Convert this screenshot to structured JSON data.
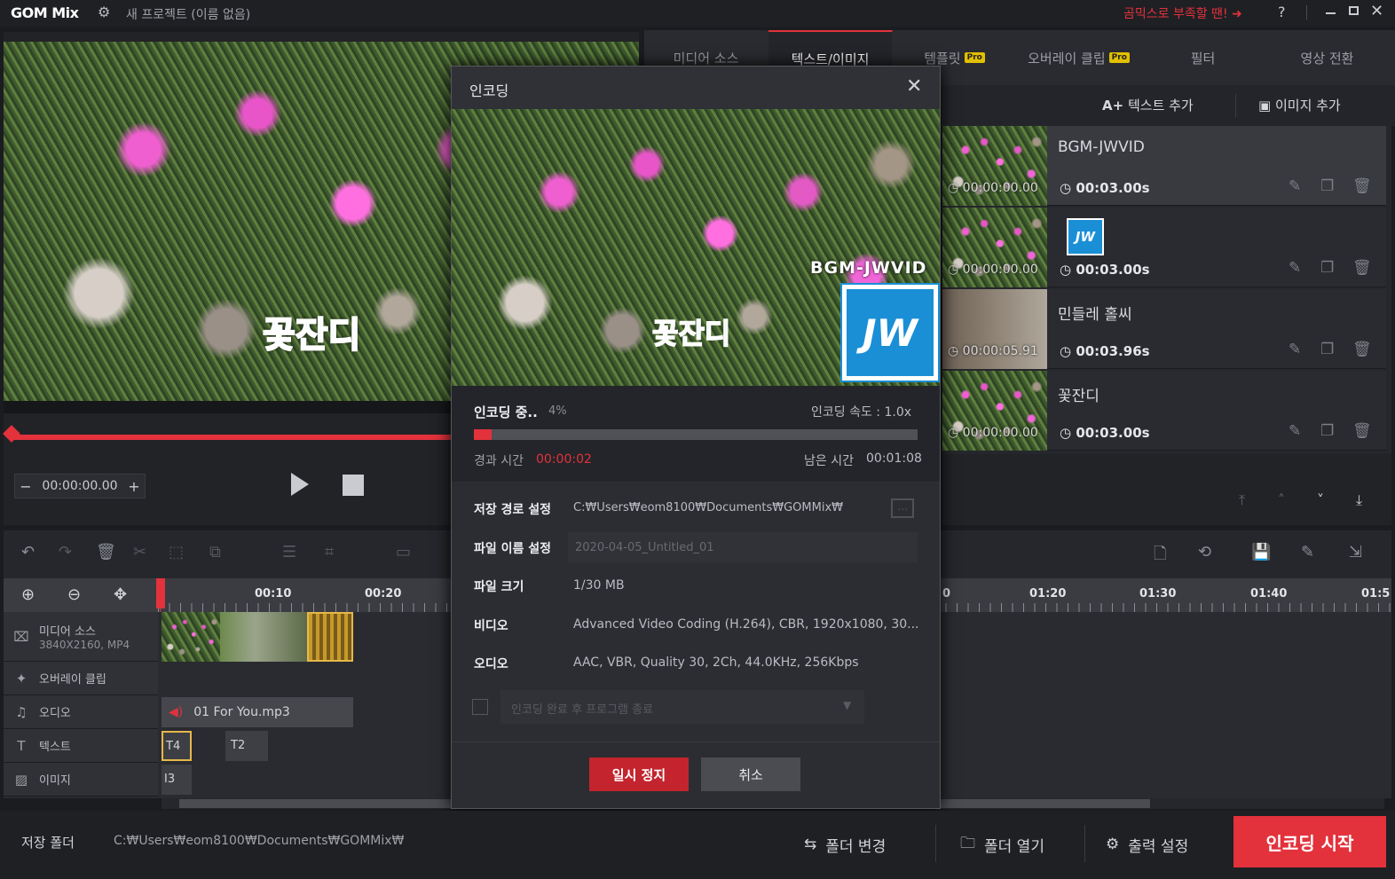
{
  "app": {
    "logo": "GOM Mix",
    "project_title": "새 프로젝트 (이름 없음)",
    "promo": "곰믹스로 부족할 땐! ➜",
    "help": "?"
  },
  "tabs": [
    {
      "label": "미디어 소스"
    },
    {
      "label": "텍스트/이미지"
    },
    {
      "label": "템플릿",
      "badge": "Pro"
    },
    {
      "label": "오버레이 클립",
      "badge": "Pro"
    },
    {
      "label": "필터"
    },
    {
      "label": "영상 전환"
    }
  ],
  "actions": {
    "add_text": "텍스트 추가",
    "add_image": "이미지 추가"
  },
  "list": [
    {
      "title": "BGM-JWVID",
      "timecode": "00:00:00.00",
      "duration": "00:03.00s"
    },
    {
      "title": "",
      "timecode": "00:00:00.00",
      "duration": "00:03.00s",
      "logo": "JW"
    },
    {
      "title": "민들레 홀씨",
      "timecode": "00:00:05.91",
      "duration": "00:03.96s"
    },
    {
      "title": "꽃잔디",
      "timecode": "00:00:00.00",
      "duration": "00:03.00s"
    }
  ],
  "preview": {
    "caption": "꽃잔디",
    "timecode": "00:00:00.00",
    "progress": 0.0
  },
  "timeline": {
    "ticks": [
      "00:10",
      "00:20",
      "0",
      "01:20",
      "01:30",
      "01:40",
      "01:5"
    ],
    "tracks": [
      {
        "label": "미디어 소스",
        "sub": "3840X2160, MP4",
        "icon": "media-icon"
      },
      {
        "label": "오버레이 클립",
        "icon": "overlay-icon"
      },
      {
        "label": "오디오",
        "icon": "note-icon"
      },
      {
        "label": "텍스트",
        "icon": "text-icon"
      },
      {
        "label": "이미지",
        "icon": "image-icon"
      }
    ],
    "audio_clip": "01 For You.mp3",
    "text_clips": [
      "T4",
      "T2"
    ],
    "image_clips": [
      "I3"
    ]
  },
  "dialog": {
    "title": "인코딩",
    "overlay_text": "BGM-JWVID",
    "caption": "꽃잔디",
    "logo": "JW",
    "status": "인코딩 중..",
    "percent": "4%",
    "progress": 0.04,
    "speed": "인코딩 속도 : 1.0x",
    "elapsed_label": "경과 시간",
    "elapsed": "00:00:02",
    "remaining_label": "남은 시간",
    "remaining": "00:01:08",
    "fields": [
      {
        "label": "저장 경로 설정",
        "value": "C:₩Users₩eom8100₩Documents₩GOMMix₩"
      },
      {
        "label": "파일 이름 설정",
        "value": "2020-04-05_Untitled_01"
      },
      {
        "label": "파일 크기",
        "value": "1/30 MB"
      },
      {
        "label": "비디오",
        "value": "Advanced Video Coding (H.264), CBR, 1920x1080, 30..."
      },
      {
        "label": "오디오",
        "value": "AAC, VBR, Quality 30, 2Ch, 44.0KHz, 256Kbps"
      }
    ],
    "quit_option": "인코딩 완료 후 프로그램 종료",
    "pause": "일시 정지",
    "cancel": "취소"
  },
  "footer": {
    "folder_label": "저장 폴더",
    "folder_path": "C:₩Users₩eom8100₩Documents₩GOMMix₩",
    "change_folder": "폴더 변경",
    "open_folder": "폴더 열기",
    "output_settings": "출력 설정",
    "start_encoding": "인코딩 시작"
  },
  "colors": {
    "accent": "#e3323c",
    "bg": "#1b1c20",
    "panel": "#2a2b30"
  }
}
